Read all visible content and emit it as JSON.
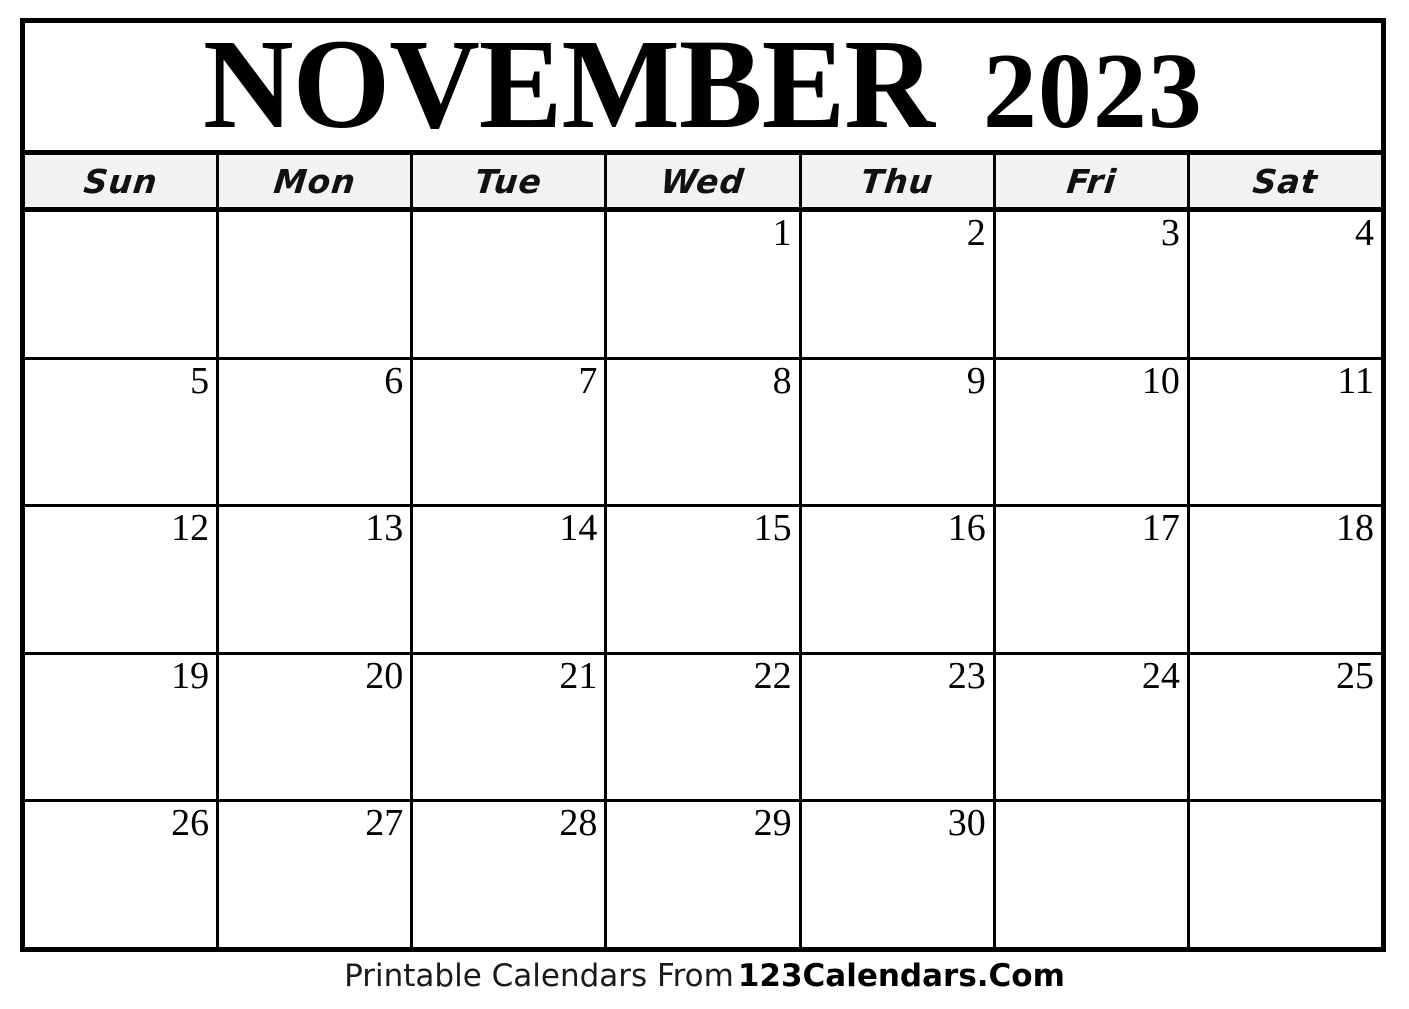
{
  "calendar": {
    "month_name": "NOVEMBER",
    "year": "2023",
    "weekday_headers": [
      "Sun",
      "Mon",
      "Tue",
      "Wed",
      "Thu",
      "Fri",
      "Sat"
    ],
    "weeks": [
      [
        "",
        "",
        "",
        "1",
        "2",
        "3",
        "4"
      ],
      [
        "5",
        "6",
        "7",
        "8",
        "9",
        "10",
        "11"
      ],
      [
        "12",
        "13",
        "14",
        "15",
        "16",
        "17",
        "18"
      ],
      [
        "19",
        "20",
        "21",
        "22",
        "23",
        "24",
        "25"
      ],
      [
        "26",
        "27",
        "28",
        "29",
        "30",
        "",
        ""
      ]
    ]
  },
  "footer": {
    "text": "Printable Calendars From",
    "brand": "123Calendars.Com"
  },
  "colors": {
    "border": "#000000",
    "header_background": "#f2f2f2",
    "page_background": "#ffffff",
    "text": "#000000"
  }
}
